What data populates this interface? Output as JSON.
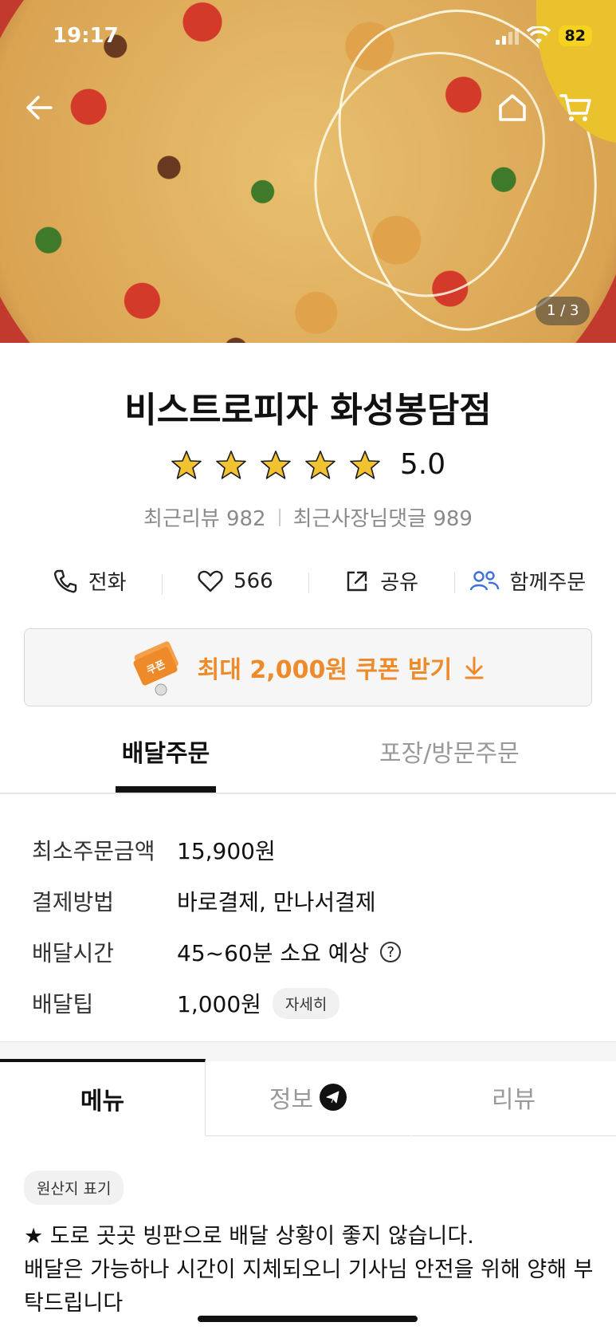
{
  "status_bar": {
    "time": "19:17",
    "battery": "82"
  },
  "hero": {
    "pager": "1 / 3"
  },
  "store": {
    "name": "비스트로피자 화성봉담점",
    "rating": "5.0",
    "stars": 5,
    "recent_reviews": "최근리뷰 982",
    "owner_replies": "최근사장님댓글 989"
  },
  "actions": {
    "call": "전화",
    "likes": "566",
    "share": "공유",
    "group_order": "함께주문"
  },
  "coupon": {
    "label": "최대 2,000원 쿠폰 받기",
    "stamp": "쿠폰"
  },
  "order_tabs": {
    "delivery": "배달주문",
    "pickup": "포장/방문주문"
  },
  "info": {
    "min_order_label": "최소주문금액",
    "min_order_value": "15,900원",
    "payment_label": "결제방법",
    "payment_value": "바로결제, 만나서결제",
    "time_label": "배달시간",
    "time_value": "45~60분 소요 예상",
    "tip_label": "배달팁",
    "tip_value": "1,000원",
    "tip_detail": "자세히"
  },
  "menu_tabs": {
    "menu": "메뉴",
    "info": "정보",
    "review": "리뷰"
  },
  "origin_chip": "원산지 표기",
  "notice": {
    "line1": "★ 도로 곳곳 빙판으로 배달 상황이 좋지 않습니다.",
    "line2": "배달은 가능하나 시간이 지체되오니 기사님 안전을 위해 양해 부탁드립니다"
  },
  "colors": {
    "accent": "#ef8a2a",
    "star": "#f2c230",
    "group_icon": "#3d6fe0"
  }
}
